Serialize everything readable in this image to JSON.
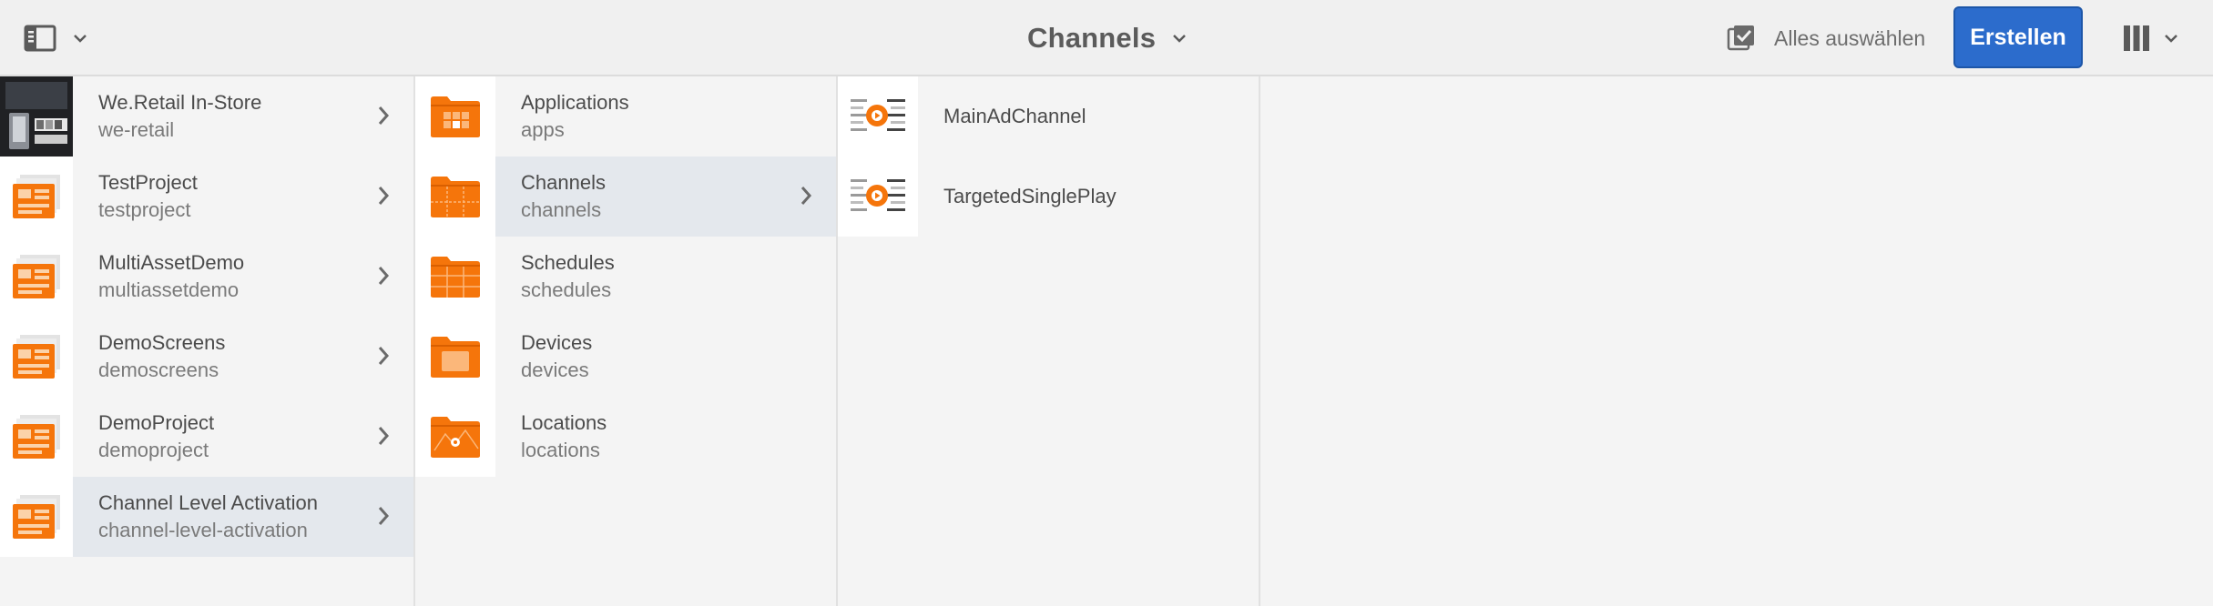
{
  "header": {
    "title": "Channels",
    "select_all_label": "Alles auswählen",
    "create_label": "Erstellen"
  },
  "colors": {
    "accent": "#2c6ccc",
    "folder_orange": "#f5750b",
    "selected_row": "#e4e8ed",
    "background": "#f4f4f4"
  },
  "column1": {
    "items": [
      {
        "name": "We.Retail In-Store",
        "sub": "we-retail",
        "icon": "photo-thumbnail"
      },
      {
        "name": "TestProject",
        "sub": "testproject",
        "icon": "screens-project-icon"
      },
      {
        "name": "MultiAssetDemo",
        "sub": "multiassetdemo",
        "icon": "screens-project-icon"
      },
      {
        "name": "DemoScreens",
        "sub": "demoscreens",
        "icon": "screens-project-icon"
      },
      {
        "name": "DemoProject",
        "sub": "demoproject",
        "icon": "screens-project-icon"
      },
      {
        "name": "Channel Level Activation",
        "sub": "channel-level-activation",
        "icon": "screens-project-icon",
        "selected": true
      }
    ]
  },
  "column2": {
    "items": [
      {
        "name": "Applications",
        "sub": "apps",
        "icon": "applications-folder-icon"
      },
      {
        "name": "Channels",
        "sub": "channels",
        "icon": "channels-folder-icon",
        "selected": true
      },
      {
        "name": "Schedules",
        "sub": "schedules",
        "icon": "schedules-folder-icon"
      },
      {
        "name": "Devices",
        "sub": "devices",
        "icon": "devices-folder-icon"
      },
      {
        "name": "Locations",
        "sub": "locations",
        "icon": "locations-folder-icon"
      }
    ]
  },
  "column3": {
    "items": [
      {
        "name": "MainAdChannel",
        "icon": "channel-icon"
      },
      {
        "name": "TargetedSinglePlay",
        "icon": "channel-icon"
      }
    ]
  }
}
